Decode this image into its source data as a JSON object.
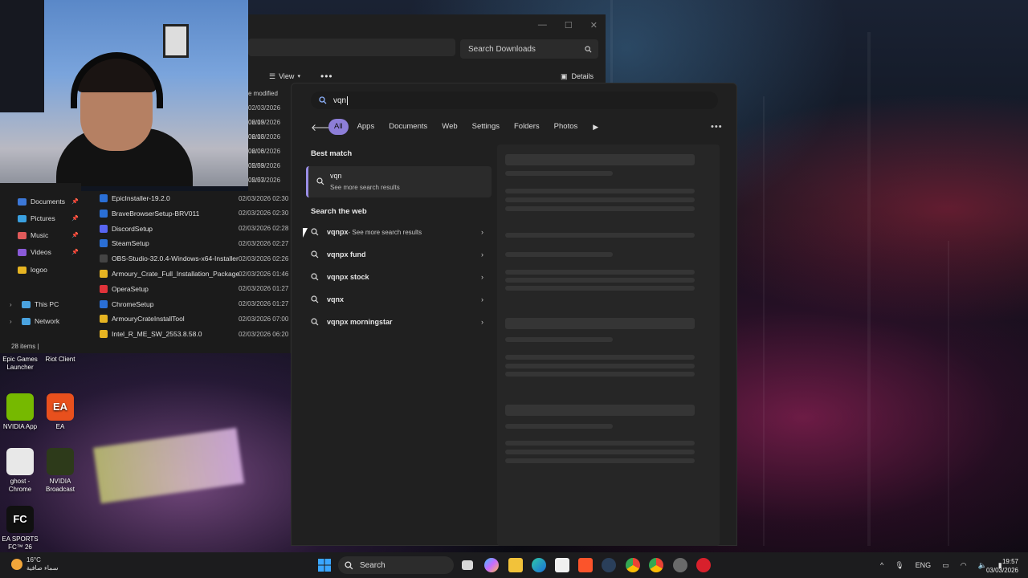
{
  "explorer": {
    "search_placeholder": "Search Downloads",
    "toolbar": {
      "view_label": "View",
      "more_label": "•••",
      "details_label": "Details"
    },
    "column_header": "e modified",
    "top_dates": [
      "02/03/2026 06:19",
      "02/03/2026 06:18",
      "02/03/2026 06:06",
      "02/03/2026 05:59",
      "02/03/2026 05:57",
      "02/03/2026 03:26"
    ],
    "nav": [
      {
        "label": "Documents",
        "icon_color": "#3c78d8",
        "pinned": true
      },
      {
        "label": "Pictures",
        "icon_color": "#3aa0e0",
        "pinned": true
      },
      {
        "label": "Music",
        "icon_color": "#e05a5a",
        "pinned": true
      },
      {
        "label": "Videos",
        "icon_color": "#8a5ad8",
        "pinned": true
      },
      {
        "label": "logoo",
        "icon_color": "#e6b422",
        "pinned": false
      }
    ],
    "nav_tree": [
      {
        "label": "This PC",
        "icon_color": "#4aa3e0"
      },
      {
        "label": "Network",
        "icon_color": "#4aa3e0"
      }
    ],
    "files": [
      {
        "name": "EpicInstaller-19.2.0",
        "date": "02/03/2026 02:30",
        "icon_color": "#2a6fd6"
      },
      {
        "name": "BraveBrowserSetup-BRV011",
        "date": "02/03/2026 02:30",
        "icon_color": "#2a6fd6"
      },
      {
        "name": "DiscordSetup",
        "date": "02/03/2026 02:28",
        "icon_color": "#5865f2"
      },
      {
        "name": "SteamSetup",
        "date": "02/03/2026 02:27",
        "icon_color": "#2a6fd6"
      },
      {
        "name": "OBS-Studio-32.0.4-Windows-x64-Installer",
        "date": "02/03/2026 02:26",
        "icon_color": "#444444"
      },
      {
        "name": "Armoury_Crate_Full_Installation_Package",
        "date": "02/03/2026 01:46",
        "icon_color": "#e6b422"
      },
      {
        "name": "OperaSetup",
        "date": "02/03/2026 01:27",
        "icon_color": "#e0333a"
      },
      {
        "name": "ChromeSetup",
        "date": "02/03/2026 01:27",
        "icon_color": "#2a6fd6"
      },
      {
        "name": "ArmouryCrateInstallTool",
        "date": "02/03/2026 07:00",
        "icon_color": "#e6b422"
      },
      {
        "name": "Intel_R_ME_SW_2553.8.58.0",
        "date": "02/03/2026 06:20",
        "icon_color": "#e6b422"
      }
    ],
    "status": "28 items  |"
  },
  "desktop_icons": [
    {
      "label": "Epic Games Launcher",
      "glyph": "",
      "color": "#2a2a2a"
    },
    {
      "label": "Riot Client",
      "glyph": "",
      "color": "#d13639"
    },
    {
      "label": "NVIDIA App",
      "glyph": "",
      "color": "#76b900"
    },
    {
      "label": "EA",
      "glyph": "EA",
      "color": "#e8501d"
    },
    {
      "label": "ghost - Chrome",
      "glyph": "",
      "color": "#e8e8e8"
    },
    {
      "label": "NVIDIA Broadcast",
      "glyph": "",
      "color": "#2d3a1a"
    },
    {
      "label": "EA SPORTS FC™ 26",
      "glyph": "FC",
      "color": "#101010"
    }
  ],
  "search": {
    "query": "vqn",
    "tabs": [
      "All",
      "Apps",
      "Documents",
      "Web",
      "Settings",
      "Folders",
      "Photos"
    ],
    "more_label": "•••",
    "best_match_heading": "Best match",
    "best_match": {
      "title": "vqn",
      "subtitle": "See more search results"
    },
    "web_heading": "Search the web",
    "web_results": [
      {
        "text": "vqnpx",
        "suffix": " - See more search results"
      },
      {
        "text": "vqnpx fund",
        "suffix": ""
      },
      {
        "text": "vqnpx stock",
        "suffix": ""
      },
      {
        "text": "vqnx",
        "suffix": ""
      },
      {
        "text": "vqnpx morningstar",
        "suffix": ""
      }
    ]
  },
  "taskbar": {
    "weather_temp": "16°C",
    "weather_desc": "سماء صافية",
    "search_label": "Search",
    "lang": "ENG",
    "time": "19:57",
    "date": "03/03/2026"
  },
  "colors": {
    "accent": "#8d7ed8",
    "panel": "#202020"
  }
}
